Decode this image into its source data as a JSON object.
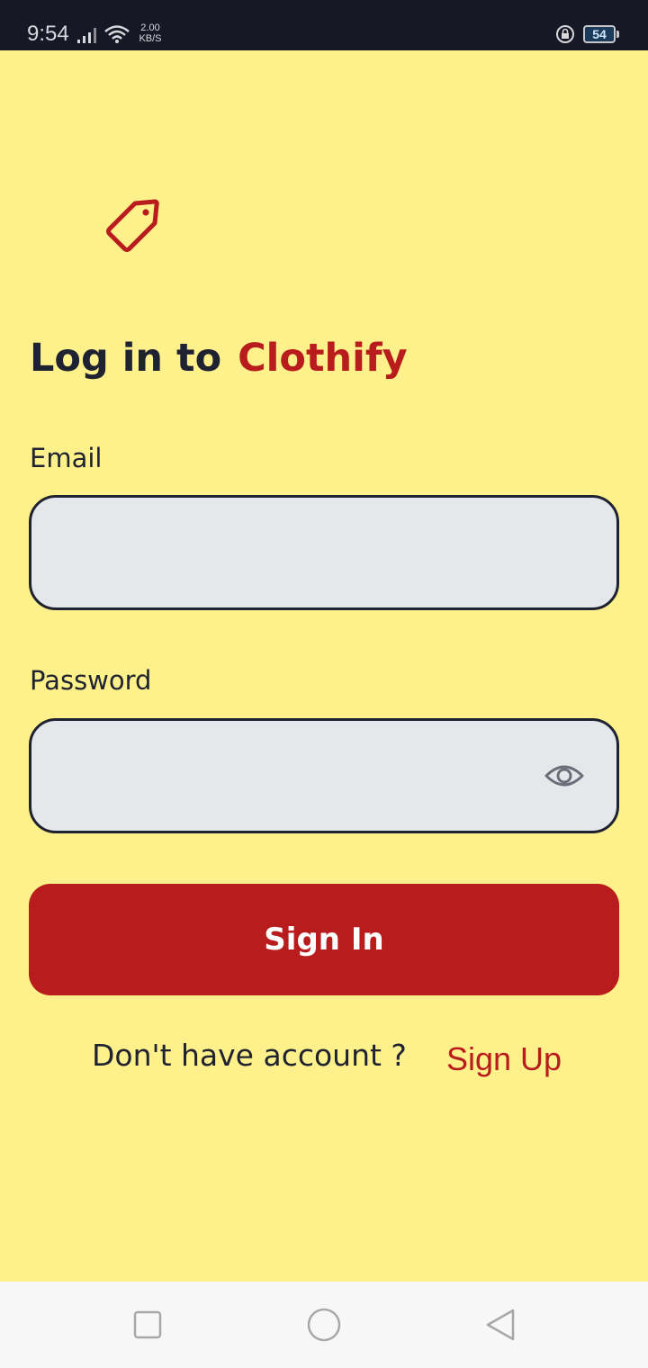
{
  "status_bar": {
    "time": "9:54",
    "net_speed_value": "2.00",
    "net_speed_unit": "KB/S",
    "battery_level": "54",
    "icons": [
      "signal-icon",
      "wifi-icon",
      "lock-rotation-icon",
      "battery-icon"
    ]
  },
  "logo": {
    "icon": "tag-icon",
    "color": "#b91c1c"
  },
  "title": {
    "prefix": "Log in to",
    "brand": "Clothify"
  },
  "form": {
    "email": {
      "label": "Email",
      "value": "",
      "placeholder": ""
    },
    "password": {
      "label": "Password",
      "value": "",
      "placeholder": "",
      "toggle_icon": "eye-icon"
    },
    "submit_label": "Sign In"
  },
  "footer": {
    "prompt": "Don't have account ?",
    "signup_label": "Sign Up"
  },
  "nav_bar": {
    "icons": [
      "recents-icon",
      "home-icon",
      "back-icon"
    ]
  },
  "colors": {
    "background": "#fef08a",
    "accent": "#b91c1c",
    "text": "#1f2230",
    "input_background": "#e5e7eb"
  }
}
